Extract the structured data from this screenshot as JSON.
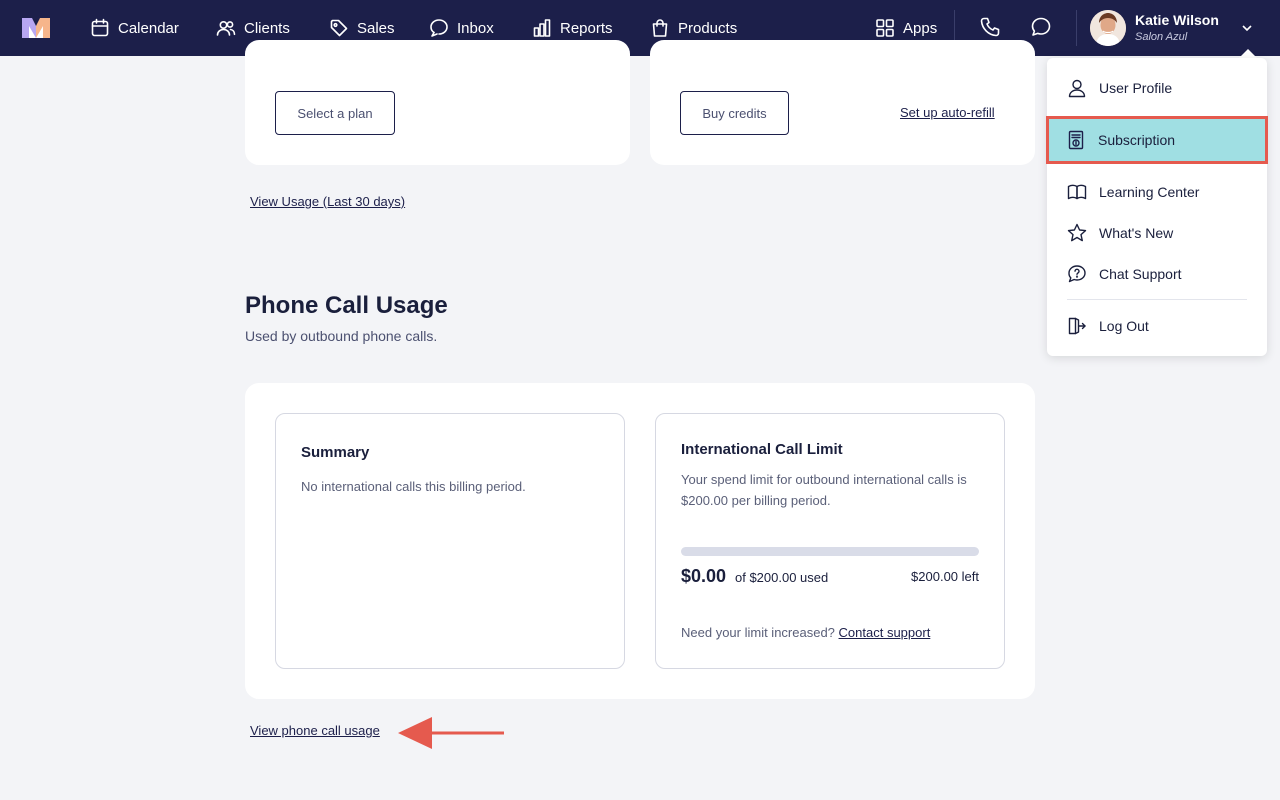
{
  "nav": {
    "items": [
      {
        "label": "Calendar",
        "icon": "calendar-icon"
      },
      {
        "label": "Clients",
        "icon": "users-icon"
      },
      {
        "label": "Sales",
        "icon": "tag-icon"
      },
      {
        "label": "Inbox",
        "icon": "inbox-icon"
      },
      {
        "label": "Reports",
        "icon": "bar-chart-icon"
      },
      {
        "label": "Products",
        "icon": "shopping-bag-icon"
      }
    ],
    "apps_label": "Apps",
    "user": {
      "name": "Katie Wilson",
      "salon": "Salon Azul"
    }
  },
  "plans": {
    "select_plan_label": "Select a plan",
    "buy_credits_label": "Buy credits",
    "auto_refill_label": "Set up auto-refill",
    "view_usage_label": "View Usage (Last 30 days)"
  },
  "phone_usage": {
    "title": "Phone Call Usage",
    "subtitle": "Used by outbound phone calls.",
    "summary": {
      "title": "Summary",
      "text": "No international calls this billing period."
    },
    "limit": {
      "title": "International Call Limit",
      "description": "Your spend limit for outbound international calls is $200.00 per billing period.",
      "used_amount": "$0.00",
      "of_text": "of $200.00 used",
      "left_text": "$200.00 left",
      "used_fraction": 0,
      "help_text": "Need your limit increased?",
      "contact_label": "Contact support"
    },
    "view_usage_label": "View phone call usage"
  },
  "dropdown": {
    "items": [
      {
        "label": "User Profile",
        "icon": "user-icon"
      },
      {
        "label": "Subscription",
        "icon": "receipt-icon",
        "active": true
      },
      {
        "label": "Learning Center",
        "icon": "book-icon"
      },
      {
        "label": "What's New",
        "icon": "star-icon"
      },
      {
        "label": "Chat Support",
        "icon": "chat-help-icon"
      },
      {
        "label": "Log Out",
        "icon": "logout-icon"
      }
    ]
  },
  "colors": {
    "nav_bg": "#1c1f4a",
    "active_menu_bg": "#a0dfe3",
    "highlight_border": "#e55a4e",
    "page_bg": "#f3f4f7"
  }
}
